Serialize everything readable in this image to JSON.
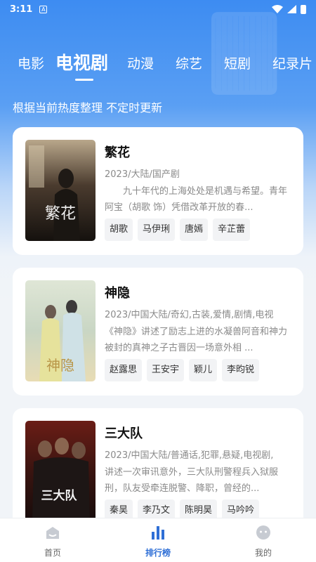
{
  "status": {
    "time": "3:11",
    "notif_glyph": "A"
  },
  "tabs": [
    {
      "label": "电影",
      "active": false
    },
    {
      "label": "电视剧",
      "active": true
    },
    {
      "label": "动漫",
      "active": false
    },
    {
      "label": "综艺",
      "active": false
    },
    {
      "label": "短剧",
      "active": false
    },
    {
      "label": "纪录片",
      "active": false
    }
  ],
  "subtitle": "根据当前热度整理 不定时更新",
  "cards": [
    {
      "title": "繁花",
      "meta": "2023/大陆/国产剧",
      "desc": "九十年代的上海处处是机遇与希望。青年阿宝（胡歌 饰）凭借改革开放的春...",
      "tags": [
        "胡歌",
        "马伊琍",
        "唐嫣",
        "辛芷蕾"
      ],
      "poster_text": "繁花",
      "poster_theme": "dark"
    },
    {
      "title": "神隐",
      "meta": "2023/中国大陆/奇幻,古装,爱情,剧情,电视",
      "desc": "《神隐》讲述了励志上进的水凝兽阿音和神力被封的真神之子古晋因一场意外相 ...",
      "tags": [
        "赵露思",
        "王安宇",
        "颖儿",
        "李昀锐"
      ],
      "poster_text": "神隐",
      "poster_theme": "light"
    },
    {
      "title": "三大队",
      "meta": "2023/中国大陆/普通话,犯罪,悬疑,电视剧,",
      "desc": "讲述一次审讯意外，三大队刑警程兵入狱服刑，队友受牵连脱警、降职，曾经的...",
      "tags": [
        "秦昊",
        "李乃文",
        "陈明昊",
        "马吟吟"
      ],
      "poster_text": "三大队",
      "poster_theme": "red"
    }
  ],
  "nav": [
    {
      "label": "首页",
      "icon": "home-icon",
      "active": false
    },
    {
      "label": "排行榜",
      "icon": "ranking-icon",
      "active": true
    },
    {
      "label": "我的",
      "icon": "profile-icon",
      "active": false
    }
  ],
  "colors": {
    "accent": "#2f6fd6",
    "hero_top": "#3d8cf2",
    "tag_bg": "#f2f3f5"
  }
}
